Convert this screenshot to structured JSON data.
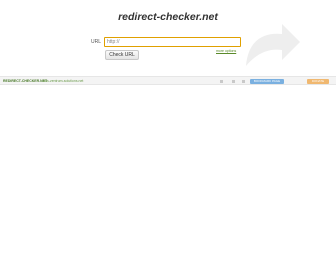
{
  "header": {
    "title": "redirect-checker.net"
  },
  "form": {
    "url_label": "URL",
    "url_value": "http://",
    "check_button_label": "Check URL",
    "more_link": "more options"
  },
  "footer": {
    "brand": "REDIRECT-CHECKER.NET",
    "subtitle": "- aus-zentrum-solutions.net",
    "icons": [
      "page-icon",
      "page-icon",
      "page-icon"
    ],
    "blue_tag_label": "BOOKMARK PAGE",
    "orange_tag_label": "DONATE"
  },
  "colors": {
    "input_border": "#e0a000",
    "footer_brand": "#4a7a2a",
    "blue_tag": "#7ab0e0",
    "orange_tag": "#f0b870",
    "arrow_decoration": "#eeeeee"
  }
}
